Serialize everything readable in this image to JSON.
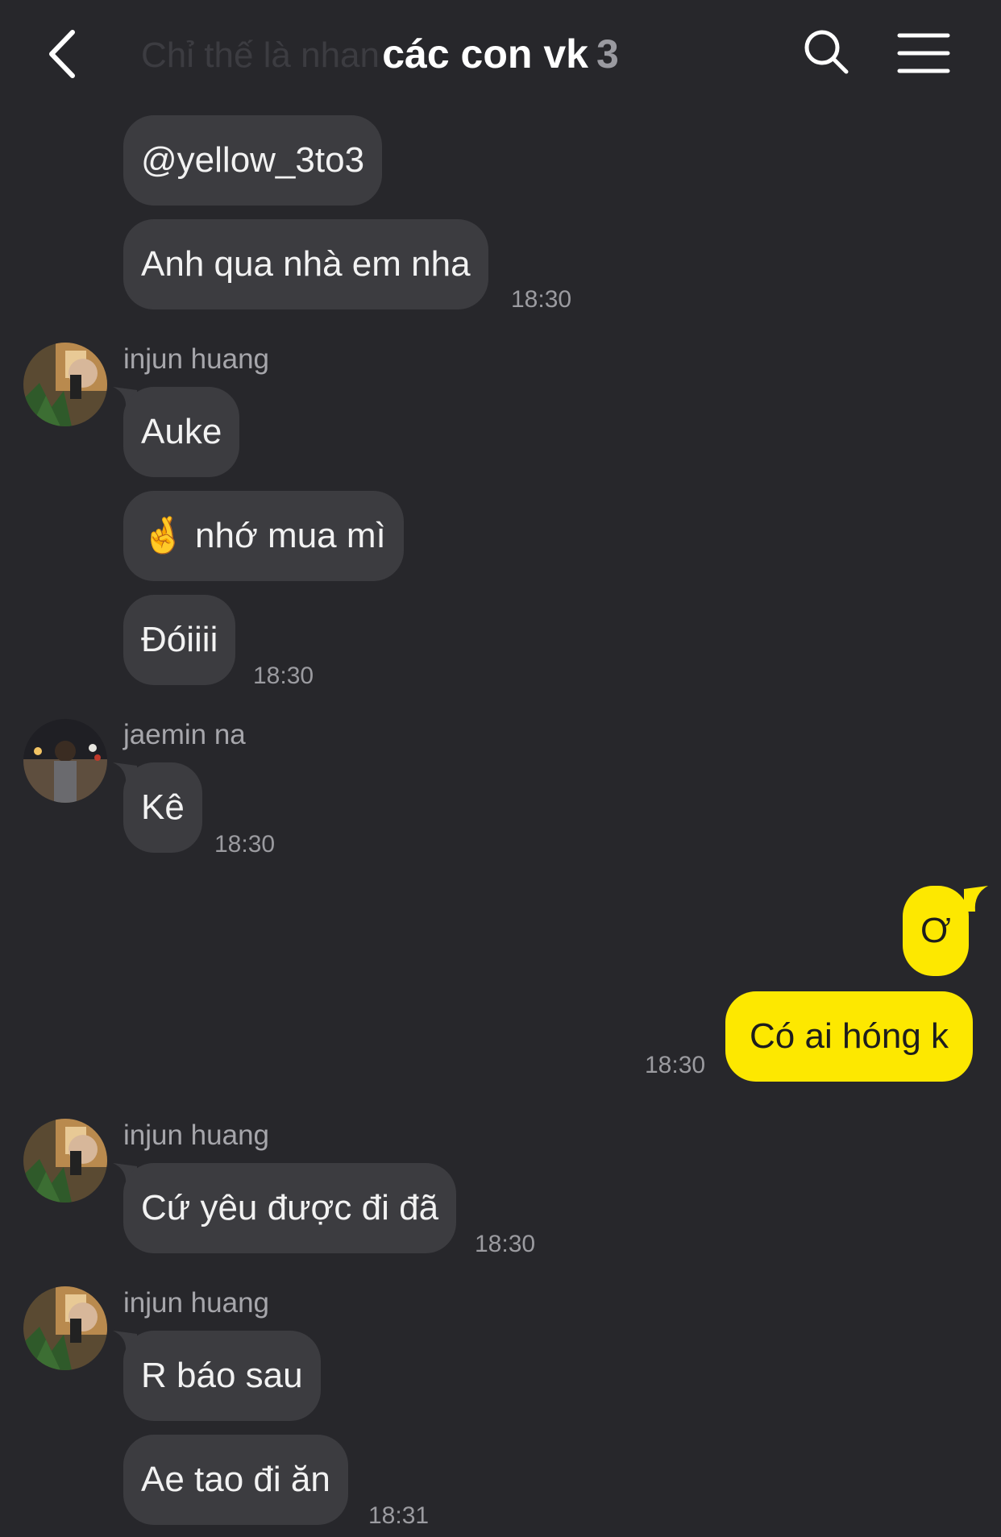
{
  "header": {
    "ghost_text": "Chỉ thế là nhan",
    "title": "các con vk",
    "member_count": "3"
  },
  "messages": {
    "m1": {
      "text": "@yellow_3to3"
    },
    "m2": {
      "text": "Anh qua nhà em nha",
      "time": "18:30"
    },
    "g1": {
      "sender": "injun huang"
    },
    "m3": {
      "text": "Auke"
    },
    "m4": {
      "text": "nhớ mua mì",
      "emoji": "🤞"
    },
    "m5": {
      "text": "Đóiiii",
      "time": "18:30"
    },
    "g2": {
      "sender": "jaemin na"
    },
    "m6": {
      "text": "Kê",
      "time": "18:30"
    },
    "m7": {
      "text": "Ơ"
    },
    "m8": {
      "text": "Có ai hóng k",
      "time": "18:30"
    },
    "g3": {
      "sender": "injun huang"
    },
    "m9": {
      "text": "Cứ yêu được đi đã",
      "time": "18:30"
    },
    "g4": {
      "sender": "injun huang"
    },
    "m10": {
      "text": "R báo sau"
    },
    "m11": {
      "text": "Ae tao đi ăn",
      "time": "18:31"
    }
  },
  "colors": {
    "background": "#27272b",
    "bubble_incoming": "#3c3c40",
    "bubble_outgoing": "#fde800"
  },
  "icons": [
    "back-icon",
    "search-icon",
    "menu-icon"
  ]
}
